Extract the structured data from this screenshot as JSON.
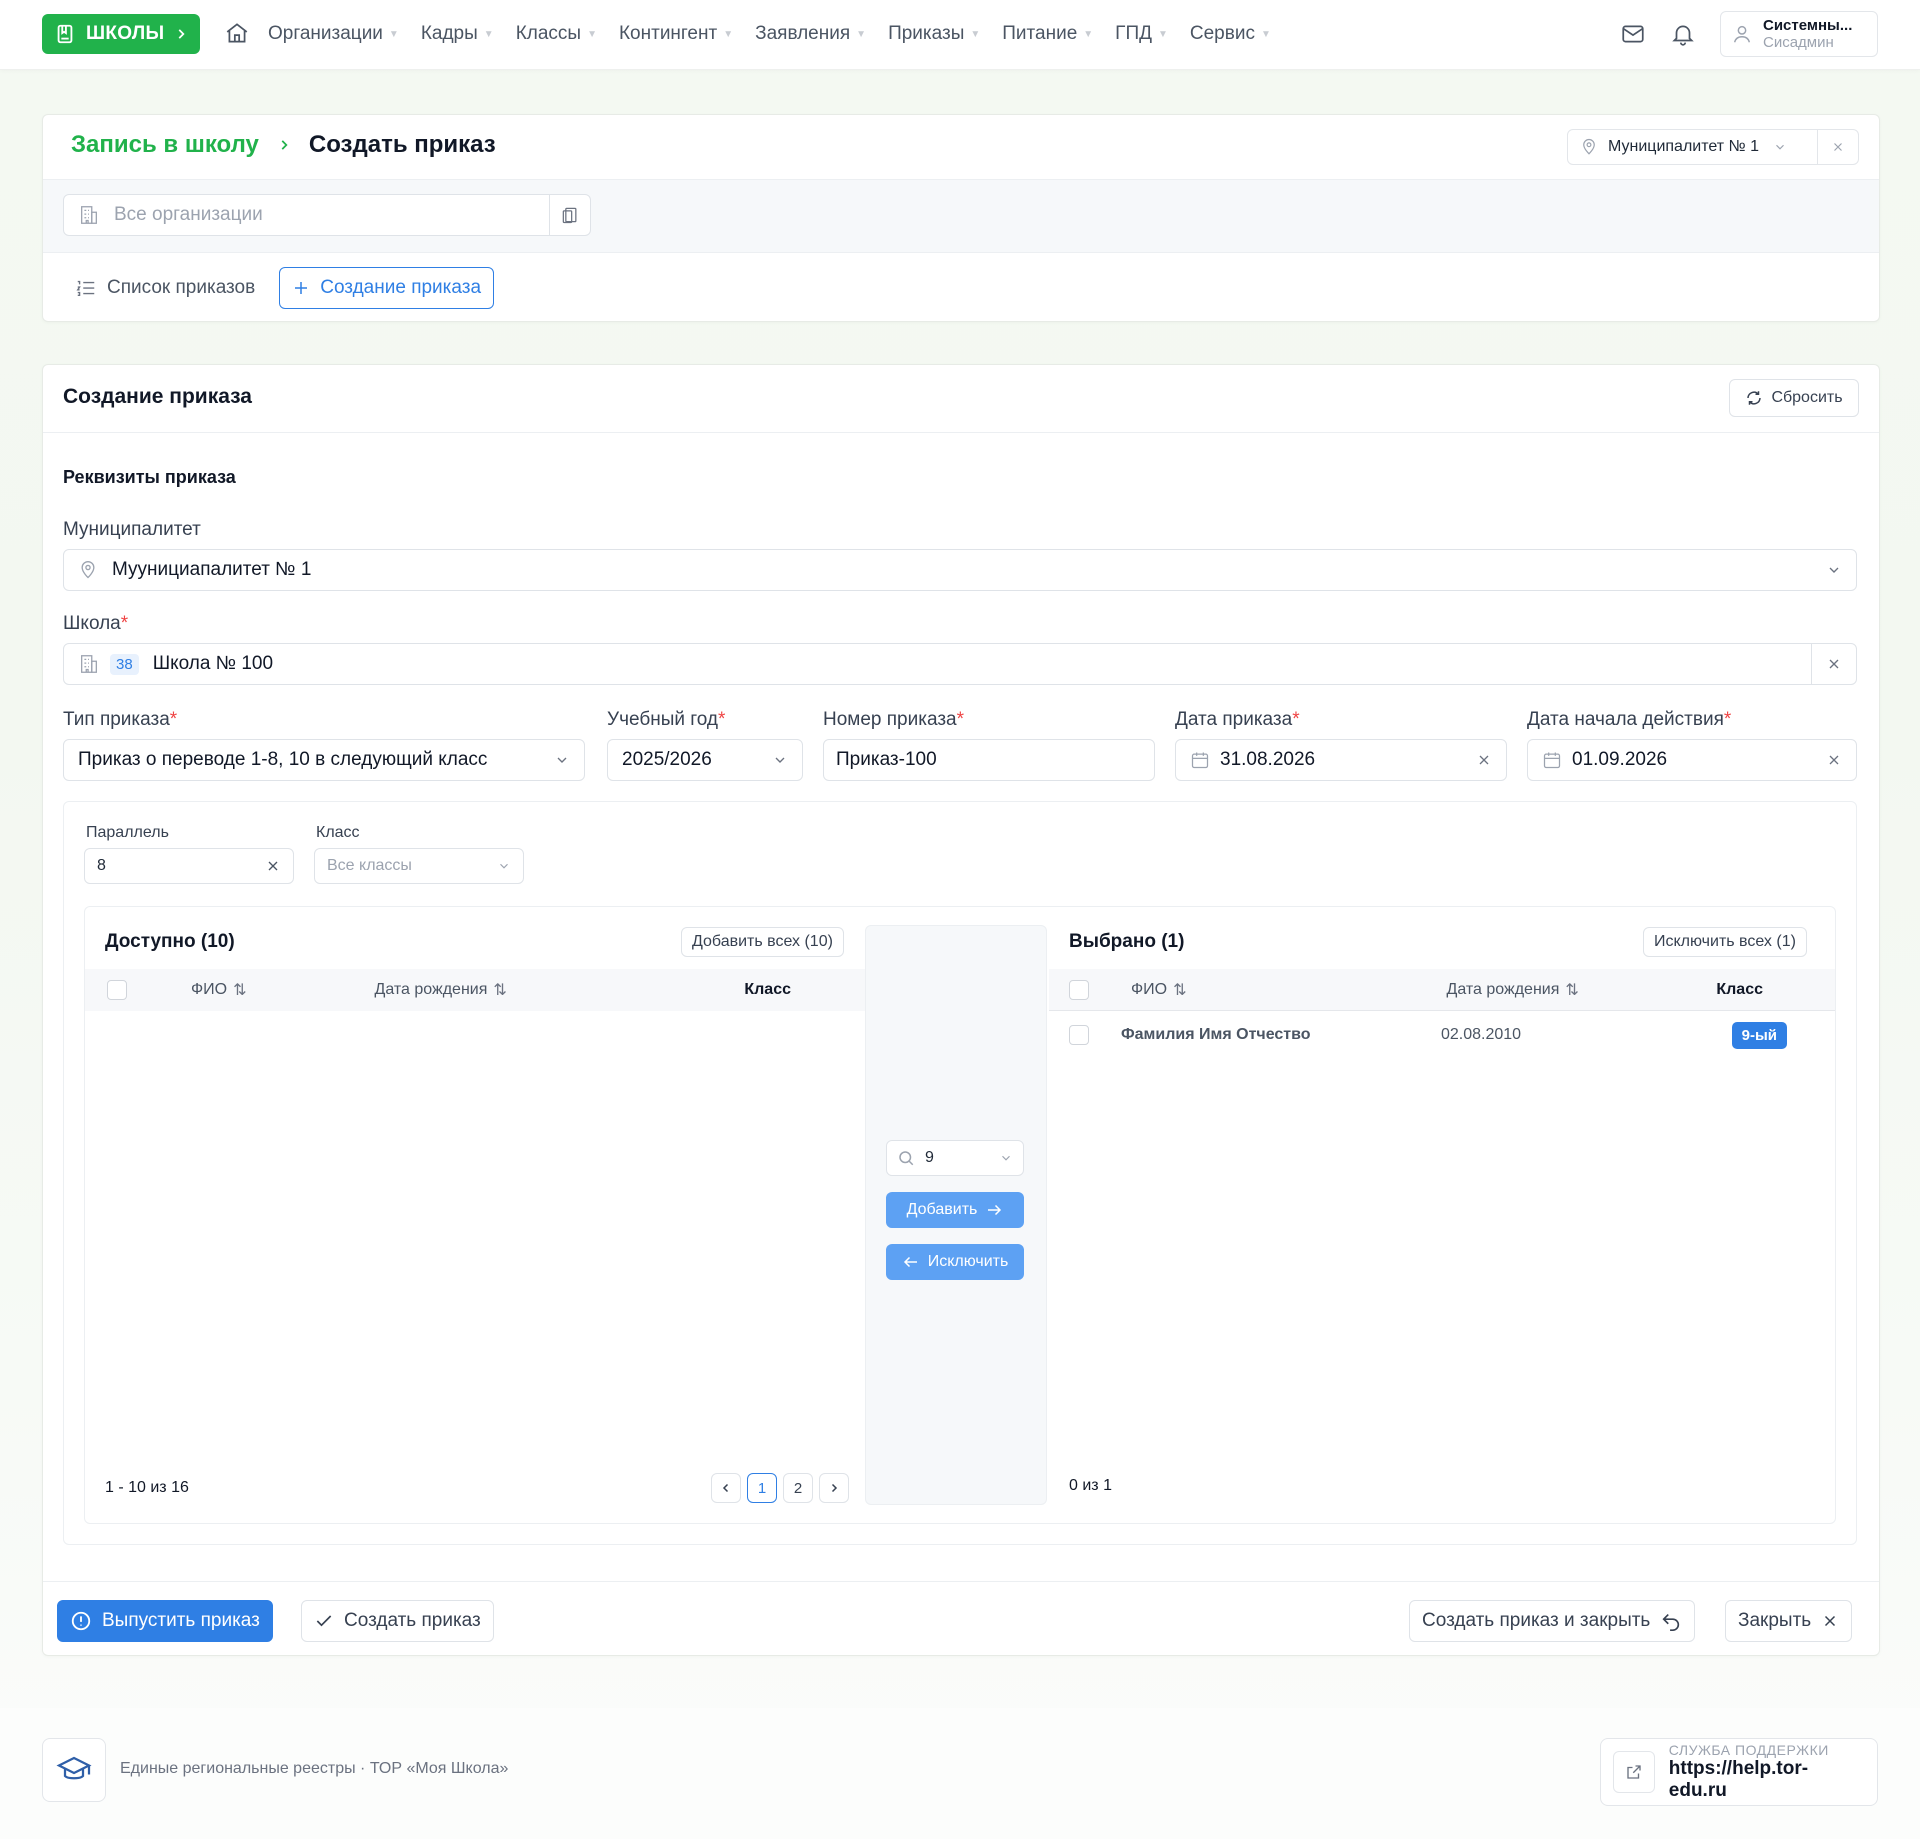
{
  "nav": {
    "brand": "ШКОЛЫ",
    "items": [
      {
        "label": "Организации"
      },
      {
        "label": "Кадры"
      },
      {
        "label": "Классы"
      },
      {
        "label": "Контингент"
      },
      {
        "label": "Заявления"
      },
      {
        "label": "Приказы"
      },
      {
        "label": "Питание"
      },
      {
        "label": "ГПД"
      },
      {
        "label": "Сервис"
      }
    ],
    "user_name": "Системны...",
    "user_role": "Сисадмин"
  },
  "header_card": {
    "breadcrumb_parent": "Запись в школу",
    "breadcrumb_current": "Создать приказ",
    "municipality_selector": "Муниципалитет № 1",
    "org_placeholder": "Все организации",
    "tab_list": "Список приказов",
    "tab_create": "Создание приказа"
  },
  "form": {
    "title": "Создание приказа",
    "reset_label": "Сбросить",
    "section_title": "Реквизиты приказа",
    "municipality_label": "Муниципалитет",
    "municipality_value": "Муунициапалитет № 1",
    "school_label": "Школа",
    "school_code": "38",
    "school_value": "Школа № 100",
    "order_type_label": "Тип приказа",
    "order_type_value": "Приказ о переводе 1-8, 10 в следующий класс",
    "year_label": "Учебный год",
    "year_value": "2025/2026",
    "number_label": "Номер приказа",
    "number_value": "Приказ-100",
    "date_label": "Дата приказа",
    "date_value": "31.08.2026",
    "start_label": "Дата начала действия",
    "start_value": "01.09.2026",
    "required_mark": "*"
  },
  "transfer": {
    "parallel_label": "Параллель",
    "parallel_value": "8",
    "class_label": "Класс",
    "class_placeholder": "Все классы",
    "available_title": "Доступно (10)",
    "add_all_label": "Добавить всех (10)",
    "selected_title": "Выбрано (1)",
    "exclude_all_label": "Исключить всех (1)",
    "col_fio": "ФИО",
    "col_birth": "Дата рождения",
    "col_class": "Класс",
    "target_class": "9",
    "add_label": "Добавить",
    "exclude_label": "Исключить",
    "available_range": "1 - 10 из 16",
    "pages": [
      "1",
      "2"
    ],
    "selected_count": "0 из 1",
    "selected_rows": [
      {
        "fio": "Фамилия Имя Отчество",
        "birth": "02.08.2010",
        "class": "9-ый"
      }
    ]
  },
  "footer_actions": {
    "publish": "Выпустить приказ",
    "create": "Создать приказ",
    "create_close": "Создать приказ и закрыть",
    "close": "Закрыть"
  },
  "page_footer": {
    "text": "Единые региональные реестры · ТОР «Моя Школа»",
    "support_label": "СЛУЖБА ПОДДЕРЖКИ",
    "support_url": "https://help.tor-edu.ru"
  },
  "colors": {
    "brand_green": "#21b24b",
    "accent_blue": "#2f7fe4",
    "required_red": "#ef4444"
  }
}
